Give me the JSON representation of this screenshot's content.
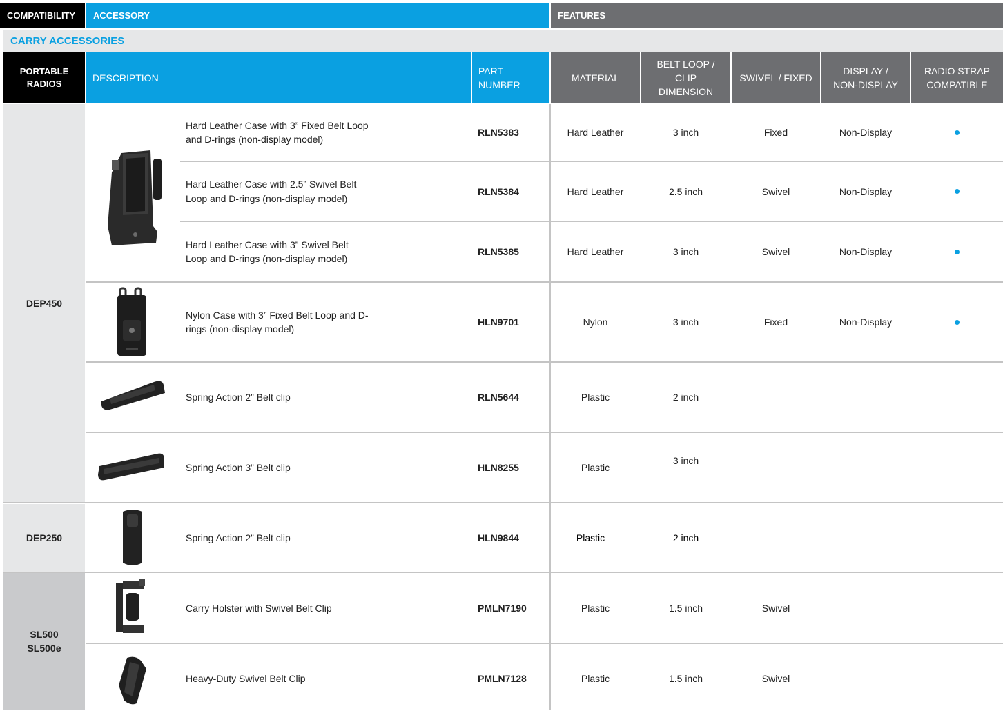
{
  "top_header": {
    "compatibility": "COMPATIBILITY",
    "accessory": "ACCESSORY",
    "features": "FEATURES"
  },
  "section_title": "CARRY ACCESSORIES",
  "columns": {
    "portable_radios": "PORTABLE RADIOS",
    "description": "DESCRIPTION",
    "part_number": "PART NUMBER",
    "material": "MATERIAL",
    "belt_loop": "BELT LOOP / CLIP DIMENSION",
    "swivel": "SWIVEL / FIXED",
    "display": "DISPLAY / NON-DISPLAY",
    "radio_strap": "RADIO STRAP COMPATIBLE"
  },
  "radio_groups": [
    {
      "name": "DEP450"
    },
    {
      "name": "DEP250"
    },
    {
      "name": "SL500\nSL500e"
    }
  ],
  "rows": [
    {
      "description": "Hard Leather Case with 3” Fixed Belt Loop and D-rings (non-display model)",
      "part": "RLN5383",
      "material": "Hard Leather",
      "dimension": "3 inch",
      "swivel": "Fixed",
      "display": "Non-Display",
      "strap": true
    },
    {
      "description": "Hard Leather Case with 2.5” Swivel Belt Loop and D-rings (non-display model)",
      "part": "RLN5384",
      "material": "Hard Leather",
      "dimension": "2.5 inch",
      "swivel": "Swivel",
      "display": "Non-Display",
      "strap": true
    },
    {
      "description": "Hard Leather Case with 3” Swivel Belt Loop and D-rings (non-display model)",
      "part": "RLN5385",
      "material": "Hard Leather",
      "dimension": "3 inch",
      "swivel": "Swivel",
      "display": "Non-Display",
      "strap": true
    },
    {
      "description": "Nylon Case with 3” Fixed Belt Loop and D-rings (non-display model)",
      "part": "HLN9701",
      "material": "Nylon",
      "dimension": "3 inch",
      "swivel": "Fixed",
      "display": "Non-Display",
      "strap": true
    },
    {
      "description": "Spring Action 2” Belt clip",
      "part": "RLN5644",
      "material": "Plastic",
      "dimension": "2 inch",
      "swivel": "",
      "display": "",
      "strap": false
    },
    {
      "description": "Spring Action 3” Belt clip",
      "part": "HLN8255",
      "material": "Plastic",
      "dimension": "3 inch",
      "swivel": "",
      "display": "",
      "strap": false
    },
    {
      "description": "Spring Action 2” Belt clip",
      "part": "HLN9844",
      "material": "Plastic",
      "dimension": "2 inch",
      "swivel": "",
      "display": "",
      "strap": false
    },
    {
      "description": "Carry Holster with Swivel Belt Clip",
      "part": "PMLN7190",
      "material": "Plastic",
      "dimension": "1.5 inch",
      "swivel": "Swivel",
      "display": "",
      "strap": false
    },
    {
      "description": "Heavy-Duty Swivel Belt Clip",
      "part": "PMLN7128",
      "material": "Plastic",
      "dimension": "1.5 inch",
      "swivel": "Swivel",
      "display": "",
      "strap": false
    }
  ],
  "colors": {
    "accent_blue": "#0aa0e1",
    "header_gray": "#6d6e71",
    "section_bg": "#e6e7e8",
    "left_col_bg": "#e6e7e8",
    "sl500_bg": "#c9cacc"
  }
}
